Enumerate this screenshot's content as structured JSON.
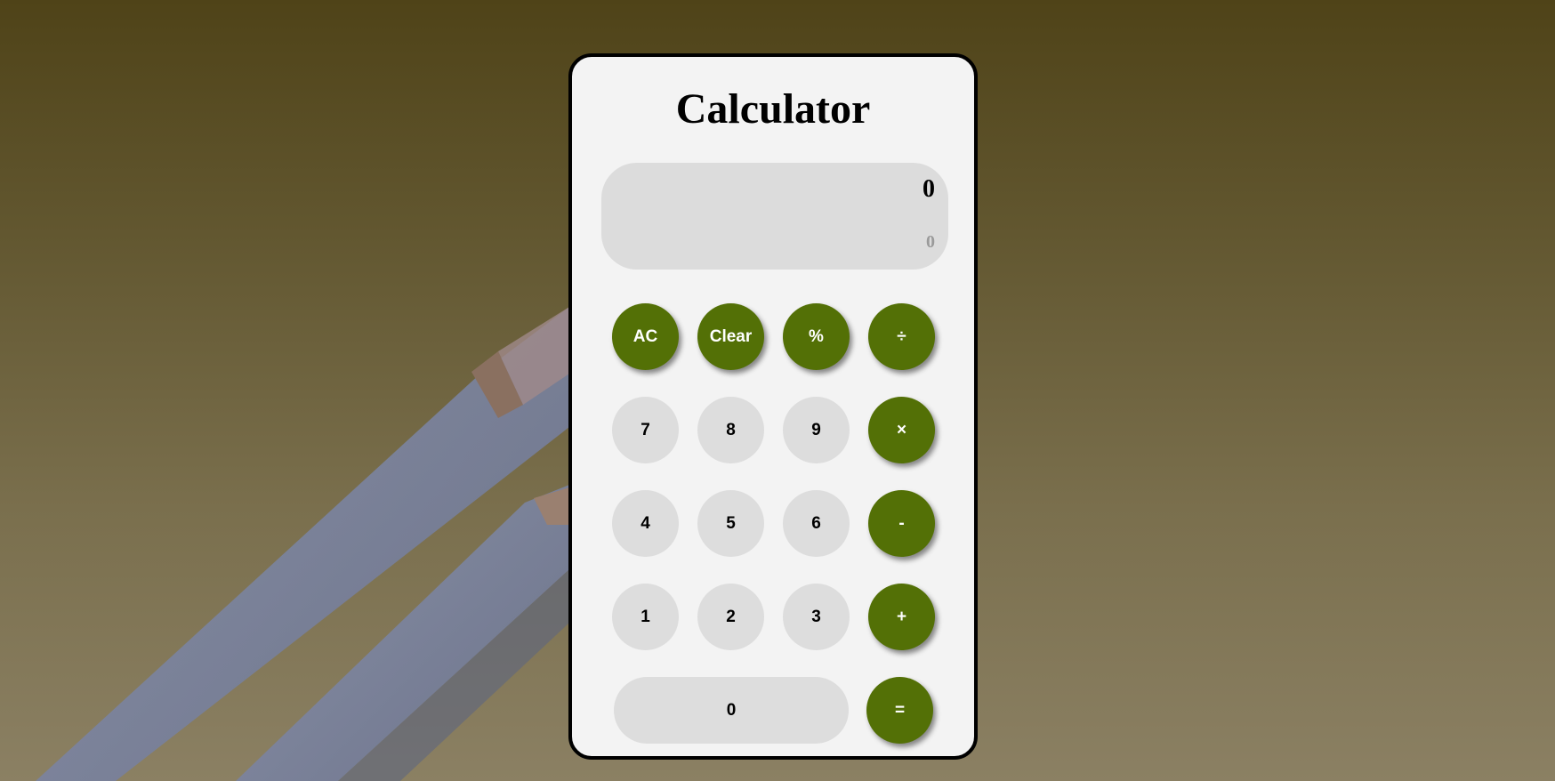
{
  "app": {
    "title": "Calculator"
  },
  "display": {
    "current": "0",
    "previous": "0"
  },
  "buttons": {
    "ac": "AC",
    "clear": "Clear",
    "percent": "%",
    "divide": "÷",
    "seven": "7",
    "eight": "8",
    "nine": "9",
    "multiply": "×",
    "four": "4",
    "five": "5",
    "six": "6",
    "subtract": "-",
    "one": "1",
    "two": "2",
    "three": "3",
    "add": "+",
    "zero": "0",
    "equals": "="
  },
  "colors": {
    "accent": "#537006",
    "key": "#dddddd",
    "panel": "#f3f3f3"
  }
}
